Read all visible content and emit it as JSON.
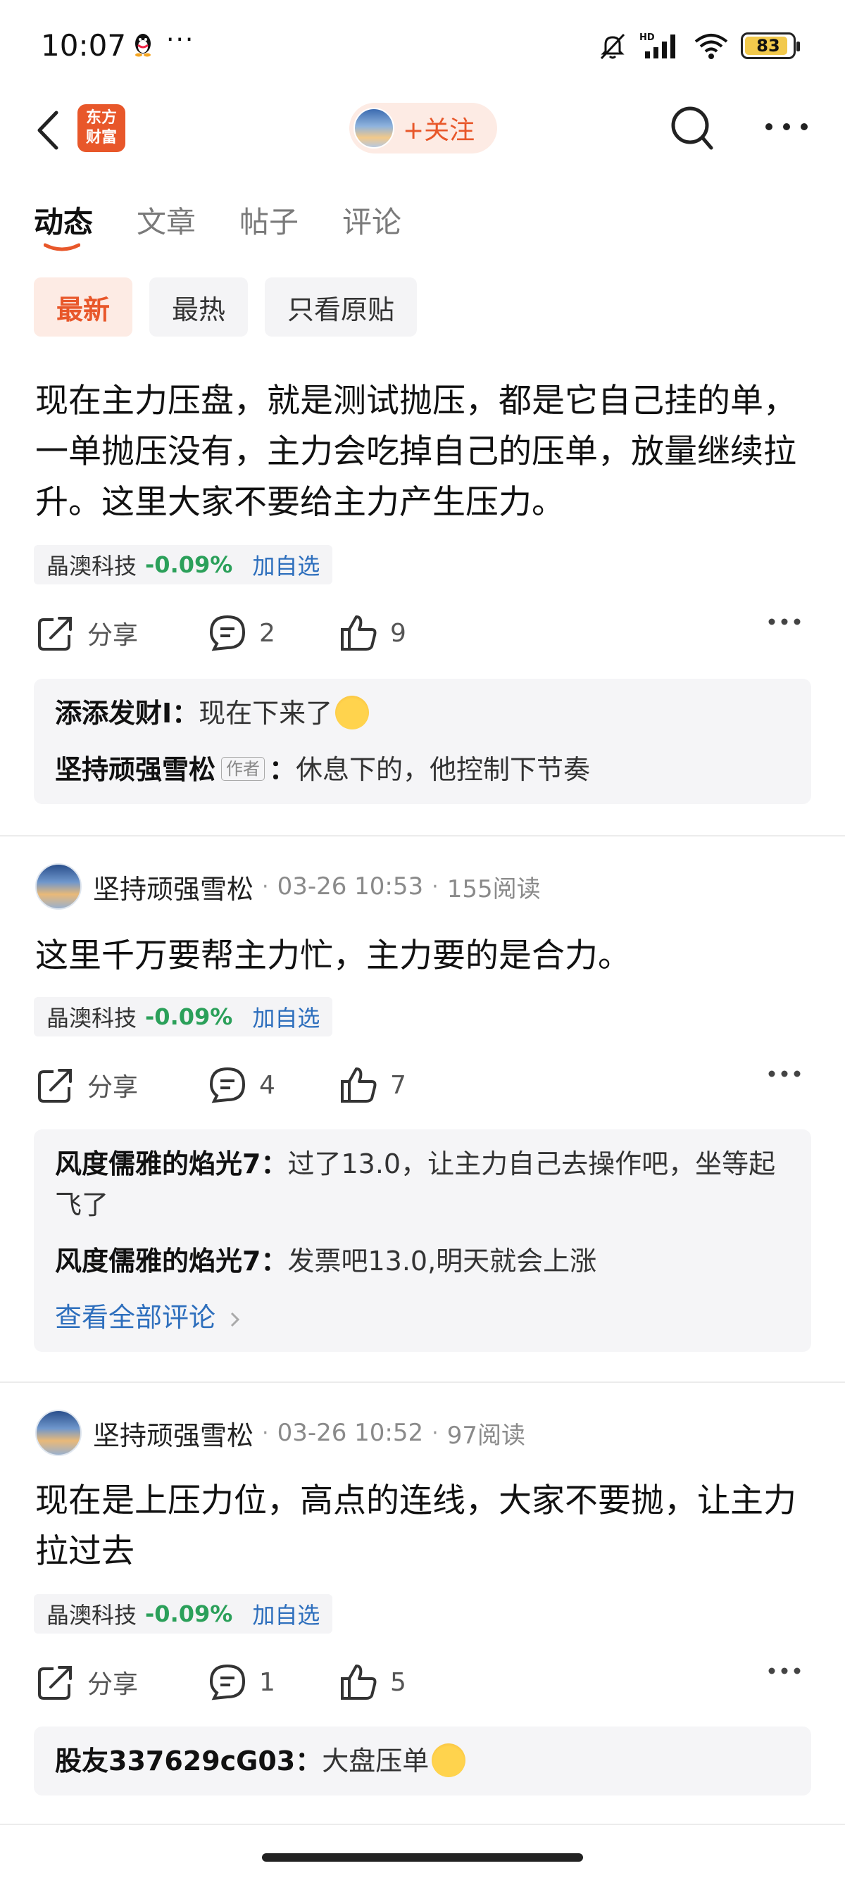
{
  "status_bar": {
    "time": "10:07",
    "dots": "···",
    "battery": "83"
  },
  "nav": {
    "logo_line1": "东方",
    "logo_line2": "财富",
    "follow_label": "+关注"
  },
  "tabs": [
    {
      "label": "动态",
      "active": true
    },
    {
      "label": "文章",
      "active": false
    },
    {
      "label": "帖子",
      "active": false
    },
    {
      "label": "评论",
      "active": false
    }
  ],
  "filters": [
    {
      "label": "最新",
      "active": true
    },
    {
      "label": "最热",
      "active": false
    },
    {
      "label": "只看原贴",
      "active": false
    }
  ],
  "posts": [
    {
      "text": "现在主力压盘，就是测试抛压，都是它自己挂的单，一单抛压没有，主力会吃掉自己的压单，放量继续拉升。这里大家不要给主力产生压力。",
      "stock": {
        "name": "晶澳科技",
        "change": "-0.09%",
        "add_label": "加自选"
      },
      "actions": {
        "share": "分享",
        "comments": "2",
        "likes": "9"
      },
      "comments": [
        {
          "user": "添添发财I",
          "text": "现在下来了"
        },
        {
          "user": "坚持顽强雪松",
          "badge": "作者",
          "text": "休息下的，他控制下节奏"
        }
      ]
    },
    {
      "author": "坚持顽强雪松",
      "time": "03-26 10:53",
      "reads": "155阅读",
      "text": "这里千万要帮主力忙，主力要的是合力。",
      "stock": {
        "name": "晶澳科技",
        "change": "-0.09%",
        "add_label": "加自选"
      },
      "actions": {
        "share": "分享",
        "comments": "4",
        "likes": "7"
      },
      "comments": [
        {
          "user": "风度儒雅的焰光7",
          "text": "过了13.0，让主力自己去操作吧，坐等起飞了"
        },
        {
          "user": "风度儒雅的焰光7",
          "text": "发票吧13.0,明天就会上涨"
        }
      ],
      "view_all": "查看全部评论"
    },
    {
      "author": "坚持顽强雪松",
      "time": "03-26 10:52",
      "reads": "97阅读",
      "text": "现在是上压力位，高点的连线，大家不要抛，让主力拉过去",
      "stock": {
        "name": "晶澳科技",
        "change": "-0.09%",
        "add_label": "加自选"
      },
      "actions": {
        "share": "分享",
        "comments": "1",
        "likes": "5"
      },
      "comments": [
        {
          "user": "股友337629cG03",
          "text": "大盘压单"
        }
      ]
    }
  ],
  "colors": {
    "accent": "#e8572a",
    "up_green": "#2ba05a",
    "link_blue": "#2e6fbd"
  }
}
